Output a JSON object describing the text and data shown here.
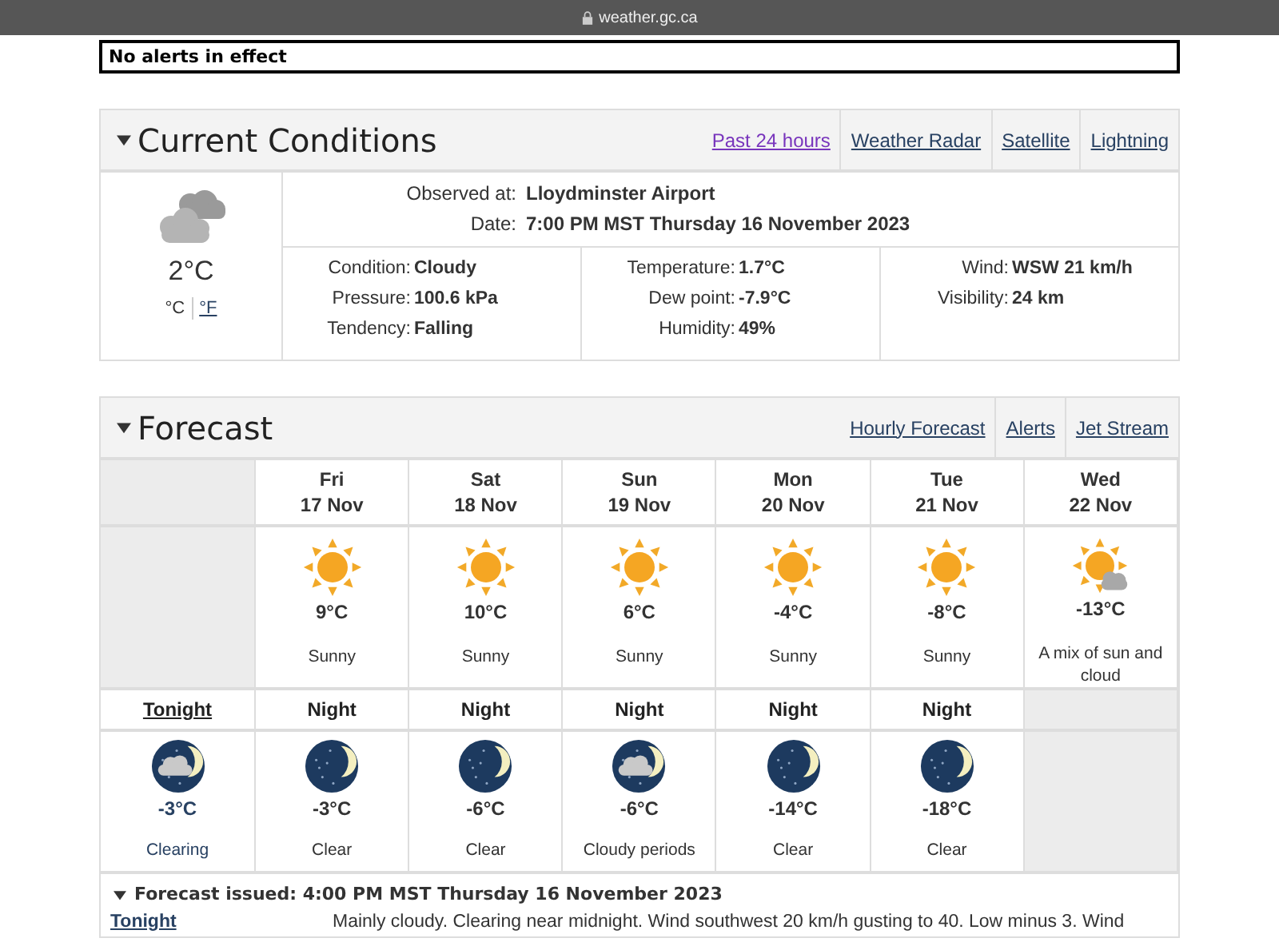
{
  "browser": {
    "url": "weather.gc.ca"
  },
  "alert": "No alerts in effect",
  "current": {
    "title": "Current Conditions",
    "expanded": true,
    "links": [
      {
        "label": "Past 24 hours",
        "visited": true
      },
      {
        "label": "Weather Radar",
        "visited": false
      },
      {
        "label": "Satellite",
        "visited": false
      },
      {
        "label": "Lightning",
        "visited": false
      }
    ],
    "kind": "cloudy",
    "temperature": "2°C",
    "units": [
      {
        "label": "°C",
        "selected": true
      },
      {
        "label": "°F",
        "selected": false
      }
    ],
    "observed": [
      {
        "label": "Observed at:",
        "value": "Lloydminster Airport"
      },
      {
        "label": "Date:",
        "value": "7:00 PM MST Thursday 16 November 2023"
      }
    ],
    "columns": [
      [
        {
          "label": "Condition:",
          "value": "Cloudy"
        },
        {
          "label": "Pressure:",
          "value": "100.6 kPa"
        },
        {
          "label": "Tendency:",
          "value": "Falling"
        }
      ],
      [
        {
          "label": "Temperature:",
          "value": "1.7°C"
        },
        {
          "label": "Dew point:",
          "value": "-7.9°C"
        },
        {
          "label": "Humidity:",
          "value": "49%"
        }
      ],
      [
        {
          "label": "Wind:",
          "value": "WSW 21 km/h"
        },
        {
          "label": "Visibility:",
          "value": "24 km"
        }
      ]
    ]
  },
  "forecast": {
    "title": "Forecast",
    "expanded": true,
    "links": [
      {
        "label": "Hourly Forecast",
        "visited": false
      },
      {
        "label": "Alerts",
        "visited": false
      },
      {
        "label": "Jet Stream",
        "visited": false
      }
    ],
    "days": [
      {
        "day": "Fri",
        "date": "17 Nov",
        "kind": "sunny",
        "temp": "9°C",
        "summary": "Sunny"
      },
      {
        "day": "Sat",
        "date": "18 Nov",
        "kind": "sunny",
        "temp": "10°C",
        "summary": "Sunny"
      },
      {
        "day": "Sun",
        "date": "19 Nov",
        "kind": "sunny",
        "temp": "6°C",
        "summary": "Sunny"
      },
      {
        "day": "Mon",
        "date": "20 Nov",
        "kind": "sunny",
        "temp": "-4°C",
        "summary": "Sunny"
      },
      {
        "day": "Tue",
        "date": "21 Nov",
        "kind": "sunny",
        "temp": "-8°C",
        "summary": "Sunny"
      },
      {
        "day": "Wed",
        "date": "22 Nov",
        "kind": "sun-cloud",
        "temp": "-13°C",
        "summary": "A mix of sun and cloud"
      }
    ],
    "nights": [
      {
        "label": "Tonight",
        "selected": true,
        "kind": "cloudy-night",
        "temp": "-3°C",
        "summary": "Clearing"
      },
      {
        "label": "Night",
        "selected": false,
        "kind": "clear-night",
        "temp": "-3°C",
        "summary": "Clear"
      },
      {
        "label": "Night",
        "selected": false,
        "kind": "clear-night",
        "temp": "-6°C",
        "summary": "Clear"
      },
      {
        "label": "Night",
        "selected": false,
        "kind": "cloudy-night",
        "temp": "-6°C",
        "summary": "Cloudy periods"
      },
      {
        "label": "Night",
        "selected": false,
        "kind": "clear-night",
        "temp": "-14°C",
        "summary": "Clear"
      },
      {
        "label": "Night",
        "selected": false,
        "kind": "clear-night",
        "temp": "-18°C",
        "summary": "Clear"
      }
    ],
    "issued": "Forecast issued: 4:00 PM MST Thursday 16 November 2023",
    "details": [
      {
        "period": "Tonight",
        "text": "Mainly cloudy. Clearing near midnight. Wind southwest 20 km/h gusting to 40. Low minus 3. Wind"
      }
    ]
  }
}
